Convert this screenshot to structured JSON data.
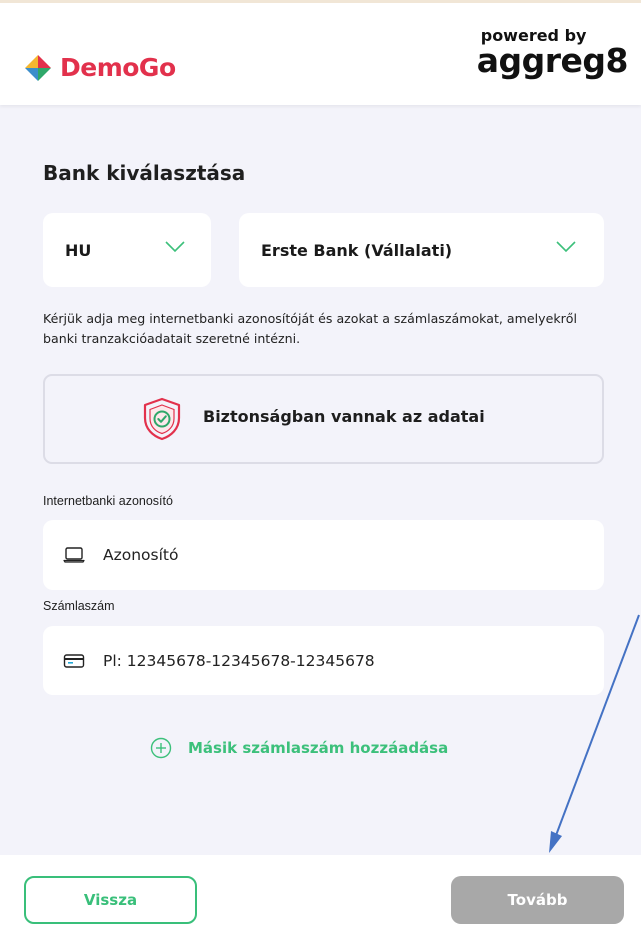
{
  "header": {
    "logo_text": "DemoGo",
    "powered_small": "powered by",
    "powered_big": "aggreg8"
  },
  "main": {
    "title": "Bank kiválasztása",
    "country_select": {
      "value": "HU"
    },
    "bank_select": {
      "value": "Erste Bank (Vállalati)"
    },
    "hint": "Kérjük adja meg internetbanki azonosítóját és azokat a számlaszámokat, amelyekről banki tranzakcióadatait szeretné intézni.",
    "secure_text": "Biztonságban vannak az adatai",
    "fields": {
      "login_label": "Internetbanki azonosító",
      "login_placeholder": "Azonosító",
      "account_label": "Számlaszám",
      "account_placeholder": "Pl: 12345678-12345678-12345678"
    },
    "add_account": "Másik számlaszám hozzáadása"
  },
  "footer": {
    "back_label": "Vissza",
    "next_label": "Tovább"
  },
  "colors": {
    "brand": "#e2314c",
    "accent_green": "#39bf7a",
    "disabled_gray": "#a8a8a8",
    "panel_bg": "#f3f3fa",
    "annotation_arrow": "#4472c4"
  },
  "icons": [
    "diamond-logo-icon",
    "chevron-down-icon",
    "shield-check-icon",
    "laptop-icon",
    "card-icon",
    "plus-circle-icon"
  ]
}
